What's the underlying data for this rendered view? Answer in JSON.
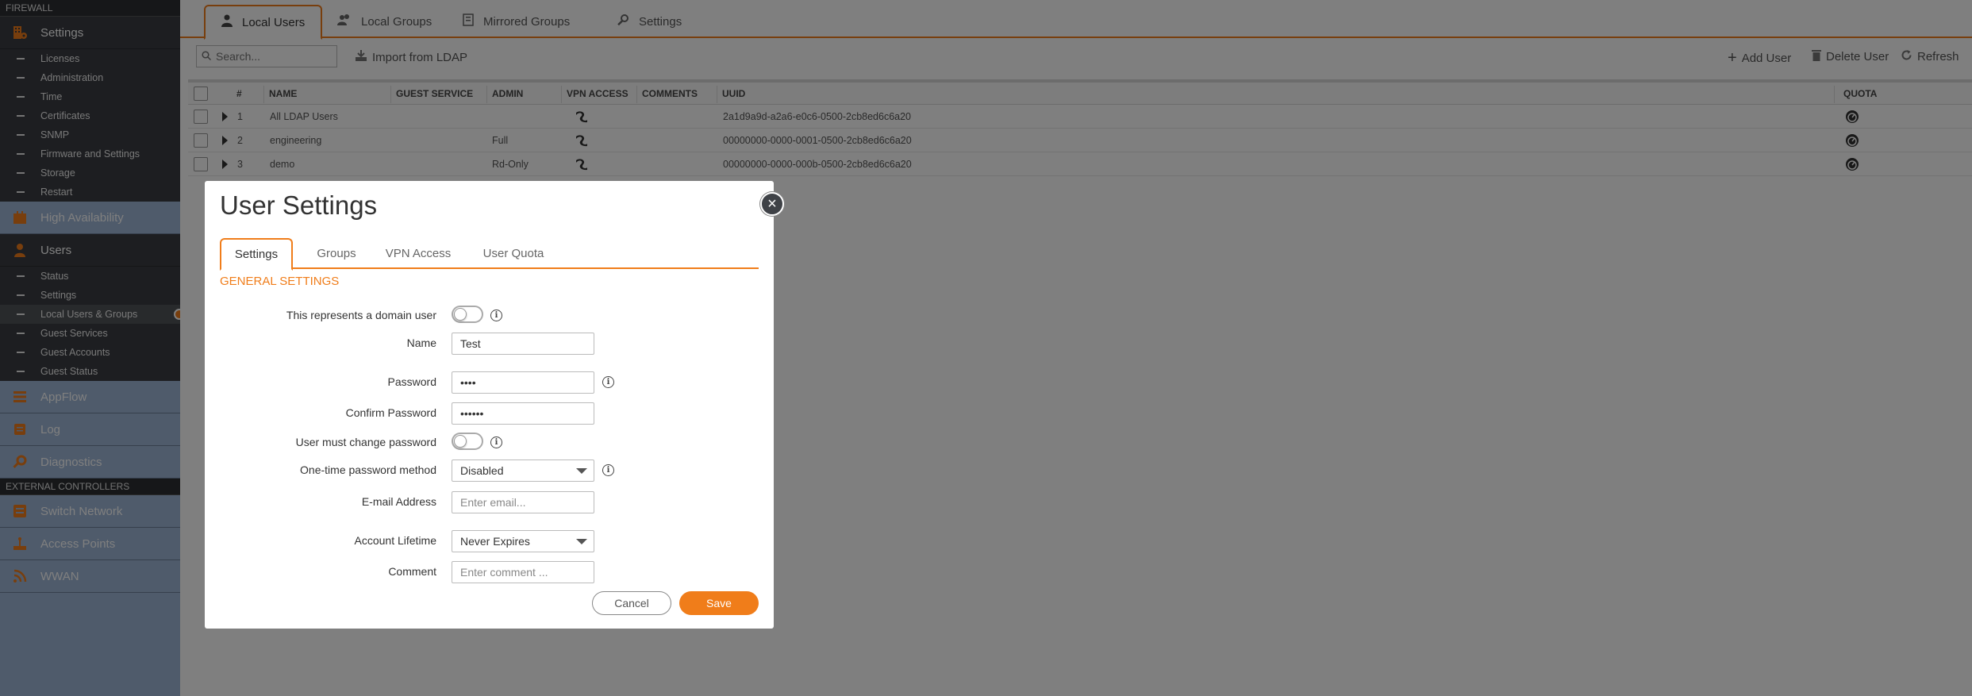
{
  "sidebar": {
    "firewall_header": "FIREWALL",
    "settings_label": "Settings",
    "settings_items": [
      "Licenses",
      "Administration",
      "Time",
      "Certificates",
      "SNMP",
      "Firmware and Settings",
      "Storage",
      "Restart"
    ],
    "high_availability_label": "High Availability",
    "users_label": "Users",
    "users_items": [
      "Status",
      "Settings",
      "Local Users & Groups",
      "Guest Services",
      "Guest Accounts",
      "Guest Status"
    ],
    "active_item": "Local Users & Groups",
    "appflow_label": "AppFlow",
    "log_label": "Log",
    "diagnostics_label": "Diagnostics",
    "external_header": "EXTERNAL CONTROLLERS",
    "switch_network_label": "Switch Network",
    "access_points_label": "Access Points",
    "wwan_label": "WWAN"
  },
  "main": {
    "tabs": [
      "Local Users",
      "Local Groups",
      "Mirrored Groups",
      "Settings"
    ],
    "active_tab": "Local Users",
    "search_placeholder": "Search...",
    "import_ldap_label": "Import from LDAP",
    "add_user_label": "Add User",
    "delete_user_label": "Delete User",
    "refresh_label": "Refresh",
    "columns": {
      "num": "#",
      "name": "NAME",
      "guest_service": "GUEST SERVICE",
      "admin": "ADMIN",
      "vpn_access": "VPN ACCESS",
      "comments": "COMMENTS",
      "uuid": "UUID",
      "quota": "QUOTA"
    },
    "rows": [
      {
        "num": "1",
        "name": "All LDAP Users",
        "admin": "",
        "uuid": "2a1d9a9d-a2a6-e0c6-0500-2cb8ed6c6a20"
      },
      {
        "num": "2",
        "name": "engineering",
        "admin": "Full",
        "uuid": "00000000-0000-0001-0500-2cb8ed6c6a20"
      },
      {
        "num": "3",
        "name": "demo",
        "admin": "Rd-Only",
        "uuid": "00000000-0000-000b-0500-2cb8ed6c6a20"
      }
    ]
  },
  "modal": {
    "title": "User Settings",
    "tabs": [
      "Settings",
      "Groups",
      "VPN Access",
      "User Quota"
    ],
    "active_tab": "Settings",
    "section_title": "GENERAL SETTINGS",
    "fields": {
      "domain_user_label": "This represents a domain user",
      "domain_user_on": false,
      "name_label": "Name",
      "name_value": "Test",
      "password_label": "Password",
      "password_value": "••••",
      "confirm_password_label": "Confirm Password",
      "confirm_password_value": "••••••",
      "must_change_label": "User must change password",
      "must_change_on": false,
      "otp_label": "One-time password method",
      "otp_value": "Disabled",
      "email_label": "E-mail Address",
      "email_placeholder": "Enter email...",
      "lifetime_label": "Account Lifetime",
      "lifetime_value": "Never Expires",
      "comment_label": "Comment",
      "comment_placeholder": "Enter comment ..."
    },
    "cancel_label": "Cancel",
    "save_label": "Save"
  },
  "colors": {
    "accent": "#f07d1a",
    "sidebar_dark": "#3a3d42",
    "sidebar_light": "#9fb6d6"
  }
}
